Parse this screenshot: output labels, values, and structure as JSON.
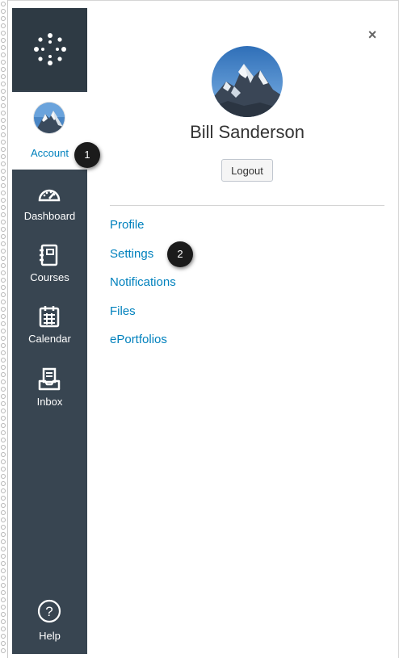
{
  "user": {
    "name": "Bill Sanderson",
    "logout_label": "Logout"
  },
  "nav": {
    "account_label": "Account",
    "items": [
      {
        "label": "Dashboard",
        "icon": "dashboard-icon"
      },
      {
        "label": "Courses",
        "icon": "courses-icon"
      },
      {
        "label": "Calendar",
        "icon": "calendar-icon"
      },
      {
        "label": "Inbox",
        "icon": "inbox-icon"
      }
    ],
    "help_label": "Help"
  },
  "tray": {
    "close_glyph": "×",
    "links": [
      {
        "label": "Profile"
      },
      {
        "label": "Settings"
      },
      {
        "label": "Notifications"
      },
      {
        "label": "Files"
      },
      {
        "label": "ePortfolios"
      }
    ]
  },
  "callouts": [
    {
      "number": "1"
    },
    {
      "number": "2"
    }
  ],
  "colors": {
    "nav_bg": "#384551",
    "logo_bg": "#2e3a44",
    "link": "#0081bd",
    "callout": "#1b1b1b"
  }
}
